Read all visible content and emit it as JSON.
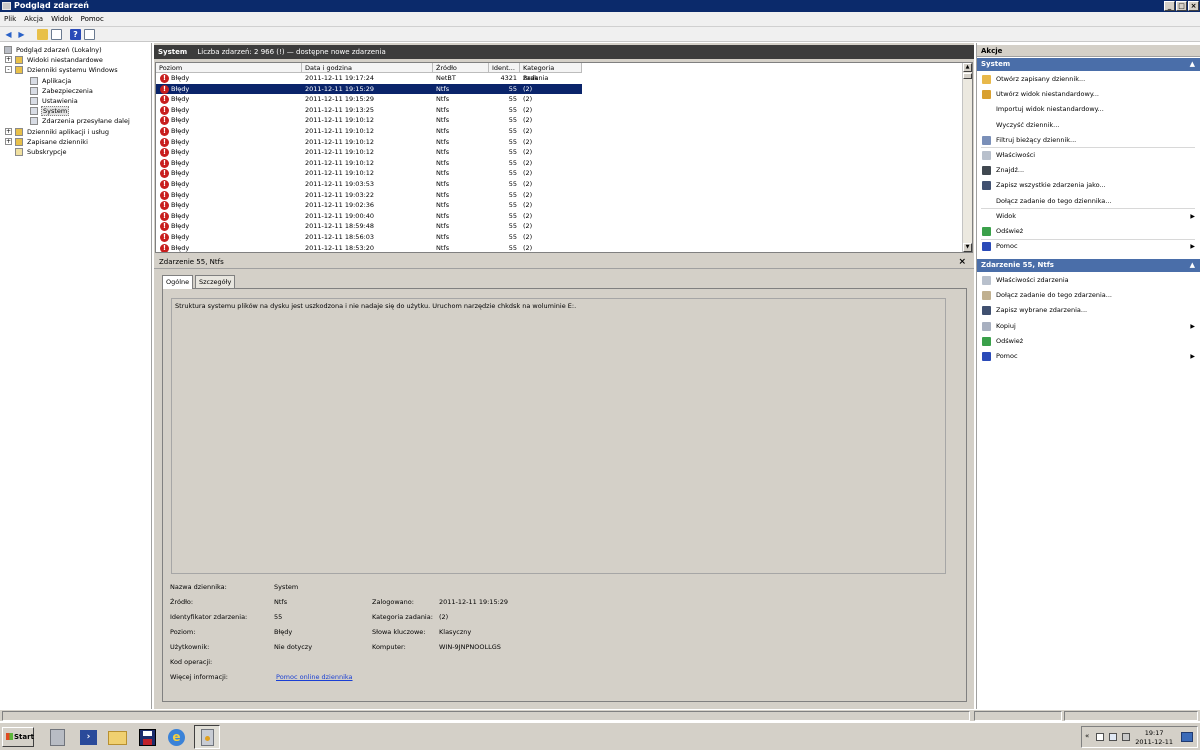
{
  "window": {
    "title": "Podgląd zdarzeń"
  },
  "menu": [
    "Plik",
    "Akcja",
    "Widok",
    "Pomoc"
  ],
  "tree": [
    {
      "label": "Podgląd zdarzeń (Lokalny)",
      "level": 0,
      "expander": ""
    },
    {
      "label": "Widoki niestandardowe",
      "level": 1,
      "expander": "+"
    },
    {
      "label": "Dzienniki systemu Windows",
      "level": 1,
      "expander": "-"
    },
    {
      "label": "Aplikacja",
      "level": 2,
      "expander": ""
    },
    {
      "label": "Zabezpieczenia",
      "level": 2,
      "expander": ""
    },
    {
      "label": "Ustawienia",
      "level": 2,
      "expander": ""
    },
    {
      "label": "System",
      "level": 2,
      "expander": "",
      "selected": true
    },
    {
      "label": "Zdarzenia przesyłane dalej",
      "level": 2,
      "expander": ""
    },
    {
      "label": "Dzienniki aplikacji i usług",
      "level": 1,
      "expander": "+"
    },
    {
      "label": "Zapisane dzienniki",
      "level": 1,
      "expander": "+"
    },
    {
      "label": "Subskrypcje",
      "level": 1,
      "expander": ""
    }
  ],
  "log_header": {
    "name": "System",
    "info": "Liczba zdarzeń: 2 966 (!) — dostępne nowe zdarzenia"
  },
  "columns": [
    "Poziom",
    "Data i godzina",
    "Źródło",
    "Ident...",
    "Kategoria zadania"
  ],
  "events": [
    {
      "level": "Błędy",
      "datetime": "2011-12-11 19:17:24",
      "source": "NetBT",
      "id": "4321",
      "category": "Brak"
    },
    {
      "level": "Błędy",
      "datetime": "2011-12-11 19:15:29",
      "source": "Ntfs",
      "id": "55",
      "category": "(2)",
      "selected": true
    },
    {
      "level": "Błędy",
      "datetime": "2011-12-11 19:15:29",
      "source": "Ntfs",
      "id": "55",
      "category": "(2)"
    },
    {
      "level": "Błędy",
      "datetime": "2011-12-11 19:13:25",
      "source": "Ntfs",
      "id": "55",
      "category": "(2)"
    },
    {
      "level": "Błędy",
      "datetime": "2011-12-11 19:10:12",
      "source": "Ntfs",
      "id": "55",
      "category": "(2)"
    },
    {
      "level": "Błędy",
      "datetime": "2011-12-11 19:10:12",
      "source": "Ntfs",
      "id": "55",
      "category": "(2)"
    },
    {
      "level": "Błędy",
      "datetime": "2011-12-11 19:10:12",
      "source": "Ntfs",
      "id": "55",
      "category": "(2)"
    },
    {
      "level": "Błędy",
      "datetime": "2011-12-11 19:10:12",
      "source": "Ntfs",
      "id": "55",
      "category": "(2)"
    },
    {
      "level": "Błędy",
      "datetime": "2011-12-11 19:10:12",
      "source": "Ntfs",
      "id": "55",
      "category": "(2)"
    },
    {
      "level": "Błędy",
      "datetime": "2011-12-11 19:10:12",
      "source": "Ntfs",
      "id": "55",
      "category": "(2)"
    },
    {
      "level": "Błędy",
      "datetime": "2011-12-11 19:03:53",
      "source": "Ntfs",
      "id": "55",
      "category": "(2)"
    },
    {
      "level": "Błędy",
      "datetime": "2011-12-11 19:03:22",
      "source": "Ntfs",
      "id": "55",
      "category": "(2)"
    },
    {
      "level": "Błędy",
      "datetime": "2011-12-11 19:02:36",
      "source": "Ntfs",
      "id": "55",
      "category": "(2)"
    },
    {
      "level": "Błędy",
      "datetime": "2011-12-11 19:00:40",
      "source": "Ntfs",
      "id": "55",
      "category": "(2)"
    },
    {
      "level": "Błędy",
      "datetime": "2011-12-11 18:59:48",
      "source": "Ntfs",
      "id": "55",
      "category": "(2)"
    },
    {
      "level": "Błędy",
      "datetime": "2011-12-11 18:56:03",
      "source": "Ntfs",
      "id": "55",
      "category": "(2)"
    },
    {
      "level": "Błędy",
      "datetime": "2011-12-11 18:53:20",
      "source": "Ntfs",
      "id": "55",
      "category": "(2)"
    }
  ],
  "detail": {
    "title": "Zdarzenie 55, Ntfs",
    "tabs": [
      "Ogólne",
      "Szczegóły"
    ],
    "description": "Struktura systemu plików na dysku jest uszkodzona i nie nadaje się do użytku. Uruchom narzędzie chkdsk na woluminie E:.",
    "labels": {
      "log_name": "Nazwa dziennika:",
      "source": "Źródło:",
      "event_id": "Identyfikator zdarzenia:",
      "level": "Poziom:",
      "user": "Użytkownik:",
      "opcode": "Kod operacji:",
      "more_info": "Więcej informacji:",
      "logged": "Zalogowano:",
      "task_category": "Kategoria zadania:",
      "keywords": "Słowa kluczowe:",
      "computer": "Komputer:"
    },
    "values": {
      "log_name": "System",
      "source": "Ntfs",
      "event_id": "55",
      "level": "Błędy",
      "user": "Nie dotyczy",
      "more_info": "Pomoc online dziennika",
      "logged": "2011-12-11 19:15:29",
      "task_category": "(2)",
      "keywords": "Klasyczny",
      "computer": "WIN-9JNPNOOLLGS"
    }
  },
  "actions": {
    "title": "Akcje",
    "system_section": "System",
    "system_items": [
      {
        "label": "Otwórz zapisany dziennik...",
        "icon": "open-folder-icon",
        "color": "#e8b84a"
      },
      {
        "label": "Utwórz widok niestandardowy...",
        "icon": "filter-icon",
        "color": "#d8a030"
      },
      {
        "label": "Importuj widok niestandardowy...",
        "icon": "",
        "color": ""
      },
      {
        "label": "Wyczyść dziennik...",
        "icon": "",
        "color": ""
      },
      {
        "label": "Filtruj bieżący dziennik...",
        "icon": "filter-icon",
        "color": "#7a8fb8"
      },
      {
        "label": "Właściwości",
        "icon": "properties-icon",
        "color": "#b8c0cc"
      },
      {
        "label": "Znajdź...",
        "icon": "binoculars-icon",
        "color": "#404850"
      },
      {
        "label": "Zapisz wszystkie zdarzenia jako...",
        "icon": "save-icon",
        "color": "#405070"
      },
      {
        "label": "Dołącz zadanie do tego dziennika...",
        "icon": "",
        "color": ""
      },
      {
        "label": "Widok",
        "icon": "",
        "color": "",
        "submenu": true
      },
      {
        "label": "Odśwież",
        "icon": "refresh-icon",
        "color": "#3aa04a"
      },
      {
        "label": "Pomoc",
        "icon": "help-icon",
        "color": "#2a4ab8",
        "submenu": true
      }
    ],
    "event_section": "Zdarzenie 55, Ntfs",
    "event_items": [
      {
        "label": "Właściwości zdarzenia",
        "icon": "properties-icon",
        "color": "#b8c0cc"
      },
      {
        "label": "Dołącz zadanie do tego zdarzenia...",
        "icon": "task-icon",
        "color": "#c0b090"
      },
      {
        "label": "Zapisz wybrane zdarzenia...",
        "icon": "save-icon",
        "color": "#405070"
      },
      {
        "label": "Kopiuj",
        "icon": "copy-icon",
        "color": "#a8b0c0",
        "submenu": true
      },
      {
        "label": "Odśwież",
        "icon": "refresh-icon",
        "color": "#3aa04a"
      },
      {
        "label": "Pomoc",
        "icon": "help-icon",
        "color": "#2a4ab8",
        "submenu": true
      }
    ]
  },
  "taskbar": {
    "start_label": "Start",
    "clock_time": "19:17",
    "clock_date": "2011-12-11"
  }
}
